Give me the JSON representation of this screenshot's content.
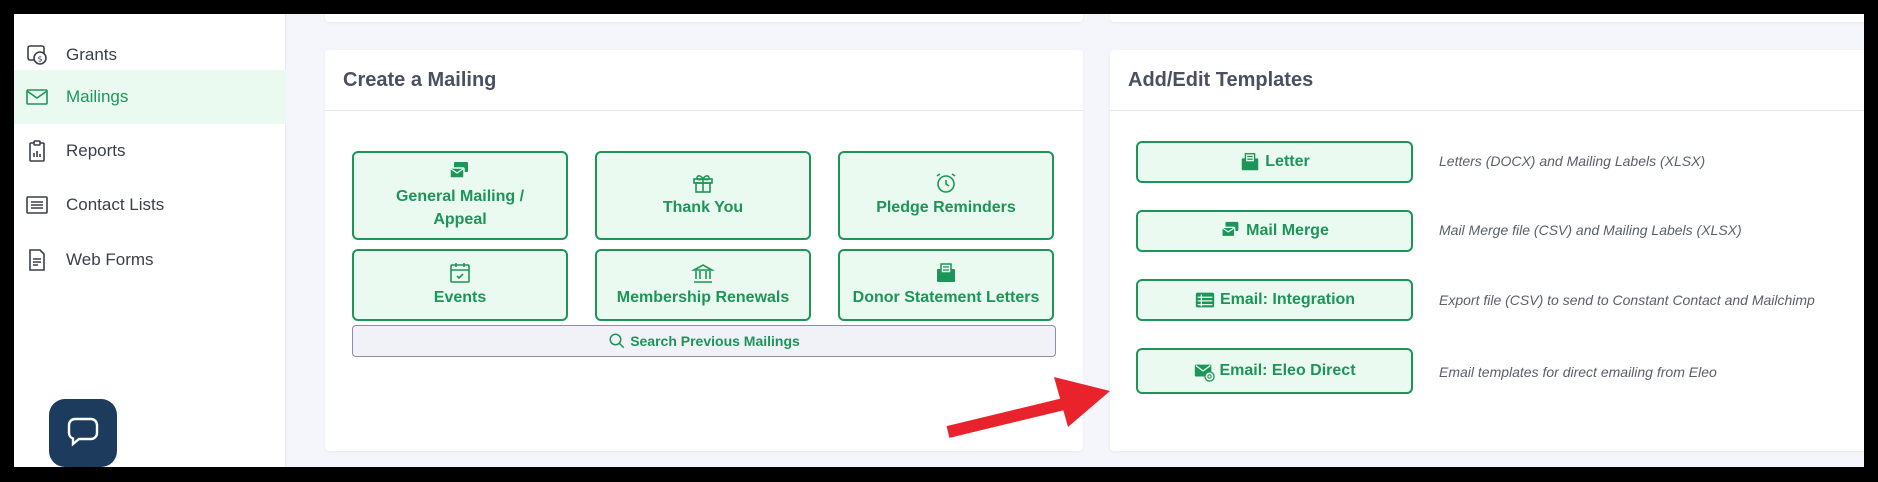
{
  "sidebar": {
    "items": [
      {
        "label": "Grants",
        "icon": "grants-icon"
      },
      {
        "label": "Mailings",
        "icon": "envelope-icon",
        "active": true
      },
      {
        "label": "Reports",
        "icon": "clipboard-icon"
      },
      {
        "label": "Contact Lists",
        "icon": "list-icon"
      },
      {
        "label": "Web Forms",
        "icon": "form-icon"
      }
    ]
  },
  "create_mailing": {
    "title": "Create a Mailing",
    "tiles": [
      {
        "line1": "General Mailing /",
        "line2": "Appeal"
      },
      {
        "label": "Thank You"
      },
      {
        "label": "Pledge Reminders"
      },
      {
        "label": "Events"
      },
      {
        "label": "Membership Renewals"
      },
      {
        "label": "Donor Statement Letters"
      }
    ],
    "search_label": "Search Previous Mailings"
  },
  "templates": {
    "title": "Add/Edit Templates",
    "items": [
      {
        "label": "Letter",
        "desc": "Letters (DOCX) and Mailing Labels (XLSX)"
      },
      {
        "label": "Mail Merge",
        "desc": "Mail Merge file (CSV) and Mailing Labels (XLSX)"
      },
      {
        "label": "Email: Integration",
        "desc": "Export file (CSV) to send to Constant Contact and Mailchimp"
      },
      {
        "label": "Email: Eleo Direct",
        "desc": "Email templates for direct emailing from Eleo"
      }
    ]
  },
  "colors": {
    "accent": "#1d9558",
    "accent_bg": "#eafaf1",
    "arrow": "#e8232b",
    "chat": "#1d3b5c"
  }
}
